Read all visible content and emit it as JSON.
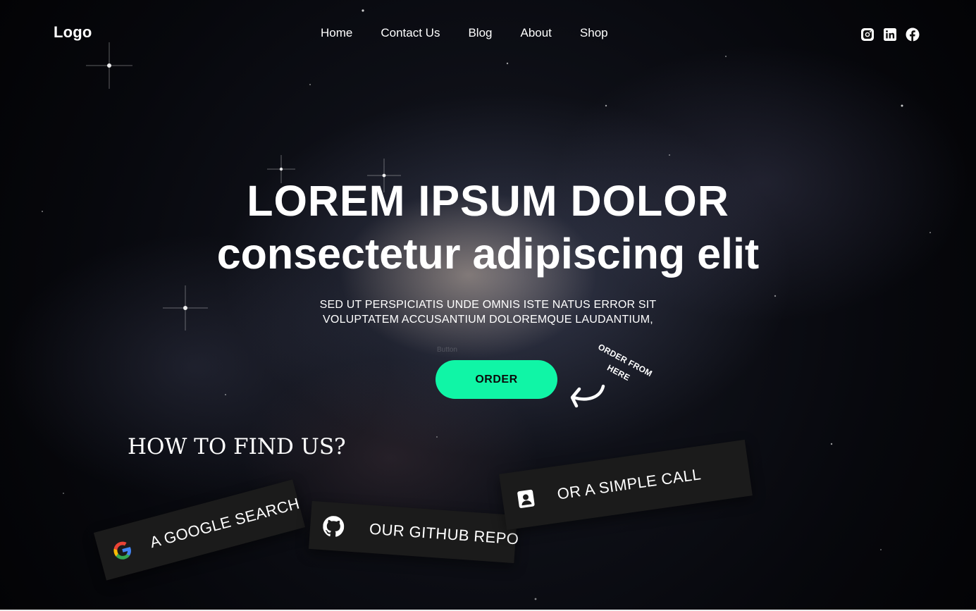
{
  "header": {
    "logo": "Logo",
    "nav": [
      "Home",
      "Contact Us",
      "Blog",
      "About",
      "Shop"
    ],
    "social_icons": [
      "instagram-icon",
      "linkedin-icon",
      "facebook-icon"
    ]
  },
  "hero": {
    "title_line1": "LOREM IPSUM DOLOR",
    "title_line2": "consectetur adipiscing elit",
    "subtitle_line1": "SED UT PERSPICIATIS UNDE OMNIS ISTE NATUS ERROR SIT",
    "subtitle_line2": "VOLUPTATEM ACCUSANTIUM DOLOREMQUE LAUDANTIUM,",
    "button_caption": "Button",
    "order_label": "ORDER",
    "hint_line1": "ORDER FROM",
    "hint_line2": "HERE"
  },
  "find_us": {
    "title": "HOW TO FIND US?",
    "cards": [
      {
        "label": "A GOOGLE SEARCH",
        "icon": "google-icon"
      },
      {
        "label": "OUR GITHUB REPO",
        "icon": "github-icon"
      },
      {
        "label": "OR A SIMPLE CALL",
        "icon": "contact-icon"
      }
    ]
  },
  "colors": {
    "accent": "#10f5a6",
    "card_bg": "#1b1b1b",
    "text": "#ffffff"
  }
}
